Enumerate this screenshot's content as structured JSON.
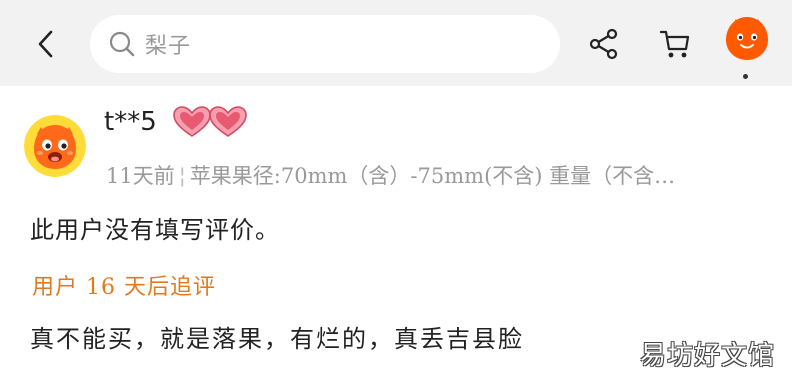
{
  "header": {
    "search": {
      "value": "梨子"
    },
    "icons": {
      "back": "chevron-left-icon",
      "search": "search-icon",
      "share": "share-icon",
      "cart": "cart-icon",
      "mascot": "mascot-icon"
    },
    "mascot_color": "#ff5a00"
  },
  "review": {
    "username": "t**5",
    "level_badge": "double-heart-icon",
    "time": "11天前",
    "separator": "¦",
    "spec": "苹果果径:70mm（含）-75mm(不含) 重量（不含…",
    "content": "此用户没有填写评价。",
    "followup": {
      "label": "用户 16 天后追评",
      "content": "真不能买，就是落果，有烂的，真丢吉县脸"
    }
  },
  "watermark": "易坊好文馆",
  "colors": {
    "followup_label": "#e07a1f",
    "topbar_bg": "#f2f2f2",
    "heart": "#e85a72"
  }
}
